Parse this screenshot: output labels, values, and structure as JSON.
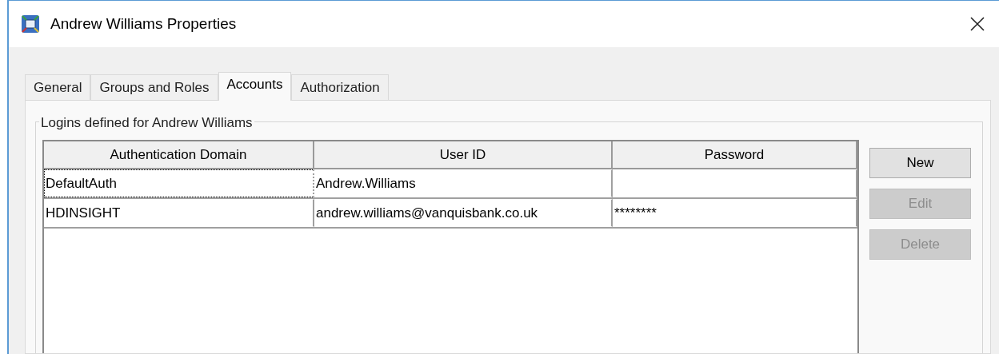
{
  "window": {
    "title": "Andrew Williams Properties"
  },
  "tabs": [
    {
      "label": "General",
      "selected": false
    },
    {
      "label": "Groups and Roles",
      "selected": false
    },
    {
      "label": "Accounts",
      "selected": true
    },
    {
      "label": "Authorization",
      "selected": false
    }
  ],
  "group": {
    "legend": "Logins defined for Andrew Williams"
  },
  "table": {
    "columns": [
      "Authentication Domain",
      "User ID",
      "Password"
    ],
    "rows": [
      {
        "cells": [
          "DefaultAuth",
          "Andrew.Williams",
          ""
        ],
        "focused": true
      },
      {
        "cells": [
          "HDINSIGHT",
          "andrew.williams@vanquisbank.co.uk",
          "********"
        ],
        "focused": false
      }
    ]
  },
  "buttons": [
    {
      "label": "New",
      "disabled": false
    },
    {
      "label": "Edit",
      "disabled": true
    },
    {
      "label": "Delete",
      "disabled": true
    }
  ]
}
